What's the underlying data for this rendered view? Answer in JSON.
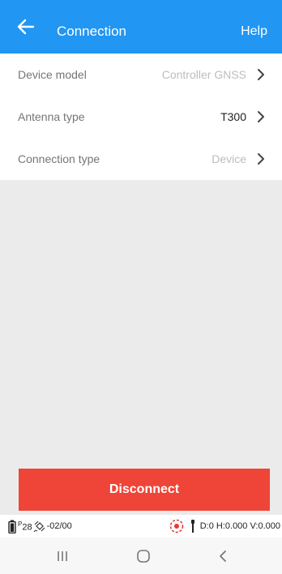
{
  "header": {
    "back_icon": "arrow-left-icon",
    "title": "Connection",
    "help_label": "Help",
    "background": "#2196f3"
  },
  "settings": {
    "rows": [
      {
        "label": "Device model",
        "value": "Controller GNSS"
      },
      {
        "label": "Antenna type",
        "value": "T300"
      },
      {
        "label": "Connection type",
        "value": "Device"
      }
    ]
  },
  "actions": {
    "disconnect_label": "Disconnect",
    "disconnect_color": "#ef4538"
  },
  "status": {
    "sat_prefix": "P",
    "sat_count": "28",
    "sat_ratio": "-02/00",
    "position_readout": "D:0 H:0.000 V:0.000"
  },
  "nav": {
    "recents_icon": "recent-apps-icon",
    "home_icon": "home-icon",
    "back_icon": "nav-back-icon"
  }
}
